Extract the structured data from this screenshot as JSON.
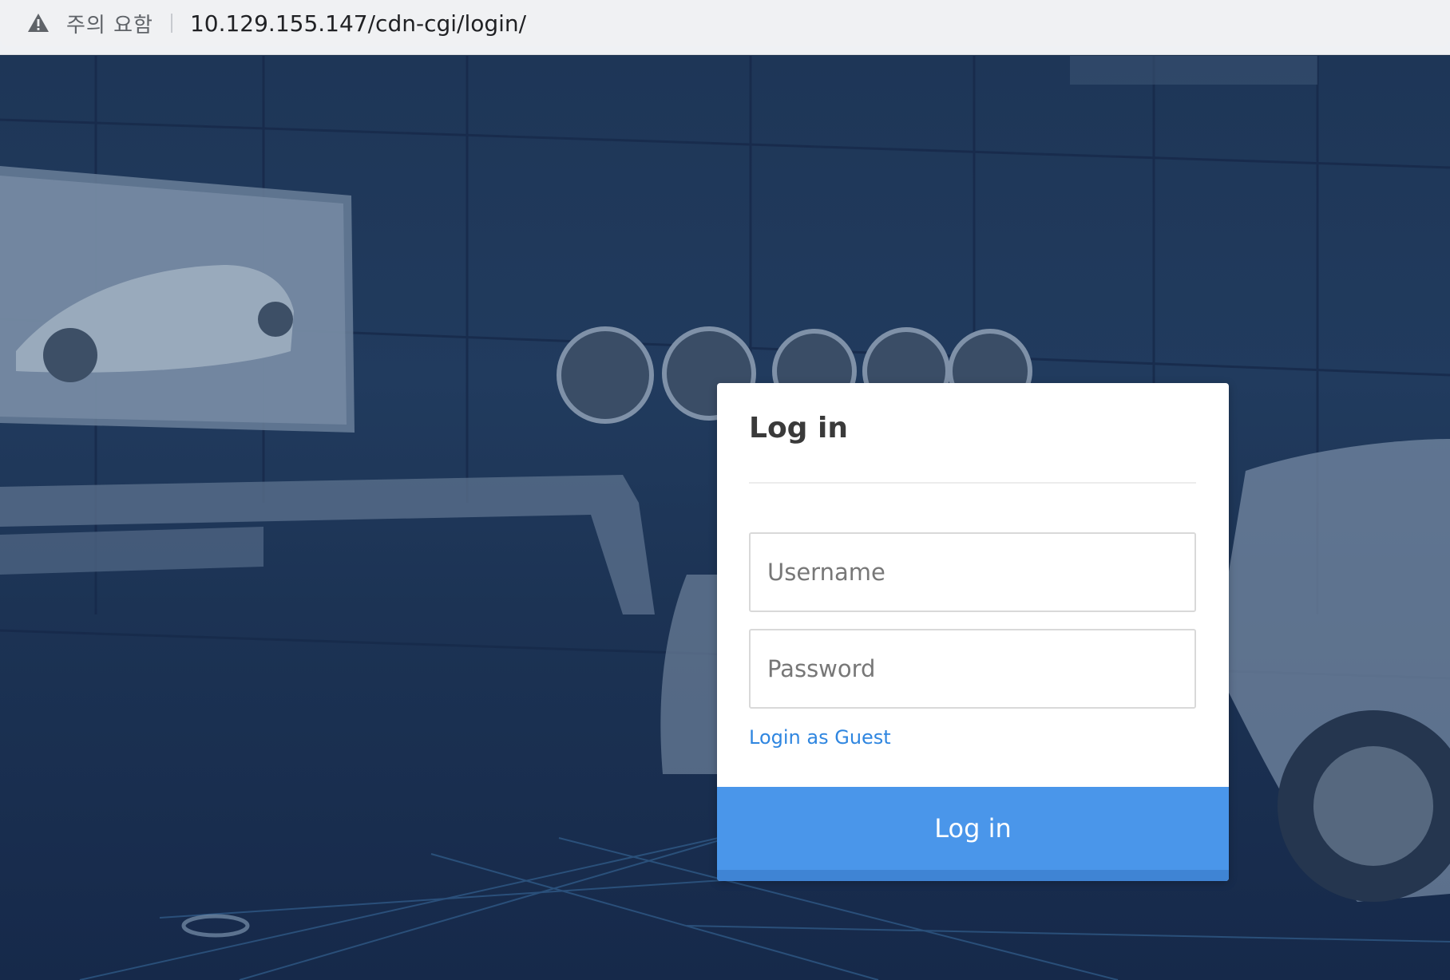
{
  "browser": {
    "security_warning": "주의 요함",
    "url": "10.129.155.147/cdn-cgi/login/"
  },
  "login_card": {
    "title": "Log in",
    "username_placeholder": "Username",
    "password_placeholder": "Password",
    "guest_link": "Login as Guest",
    "submit_label": "Log in"
  },
  "colors": {
    "accent": "#4a96ea",
    "link": "#2f86e0",
    "overlay": "#1e3657"
  }
}
